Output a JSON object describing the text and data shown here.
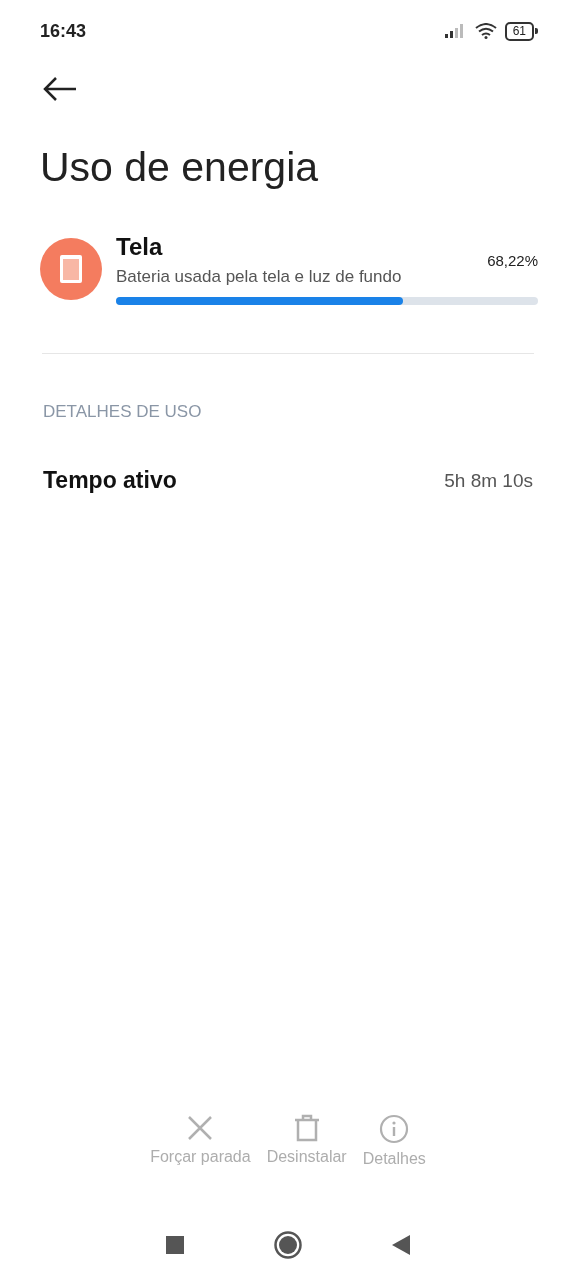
{
  "status_bar": {
    "time": "16:43",
    "battery": "61"
  },
  "title": "Uso de energia",
  "usage": {
    "name": "Tela",
    "description": "Bateria usada pela tela e luz de fundo",
    "percent": "68,22%",
    "level": 0.68
  },
  "section": {
    "header": "DETALHES DE USO",
    "rows": [
      {
        "label": "Tempo ativo",
        "value": "5h 8m 10s"
      }
    ]
  },
  "actions": [
    {
      "kind": "close",
      "label": "Forçar parada",
      "disabled": true
    },
    {
      "kind": "trash",
      "label": "Desinstalar",
      "disabled": true
    },
    {
      "kind": "info",
      "label": "Detalhes",
      "disabled": true
    }
  ]
}
